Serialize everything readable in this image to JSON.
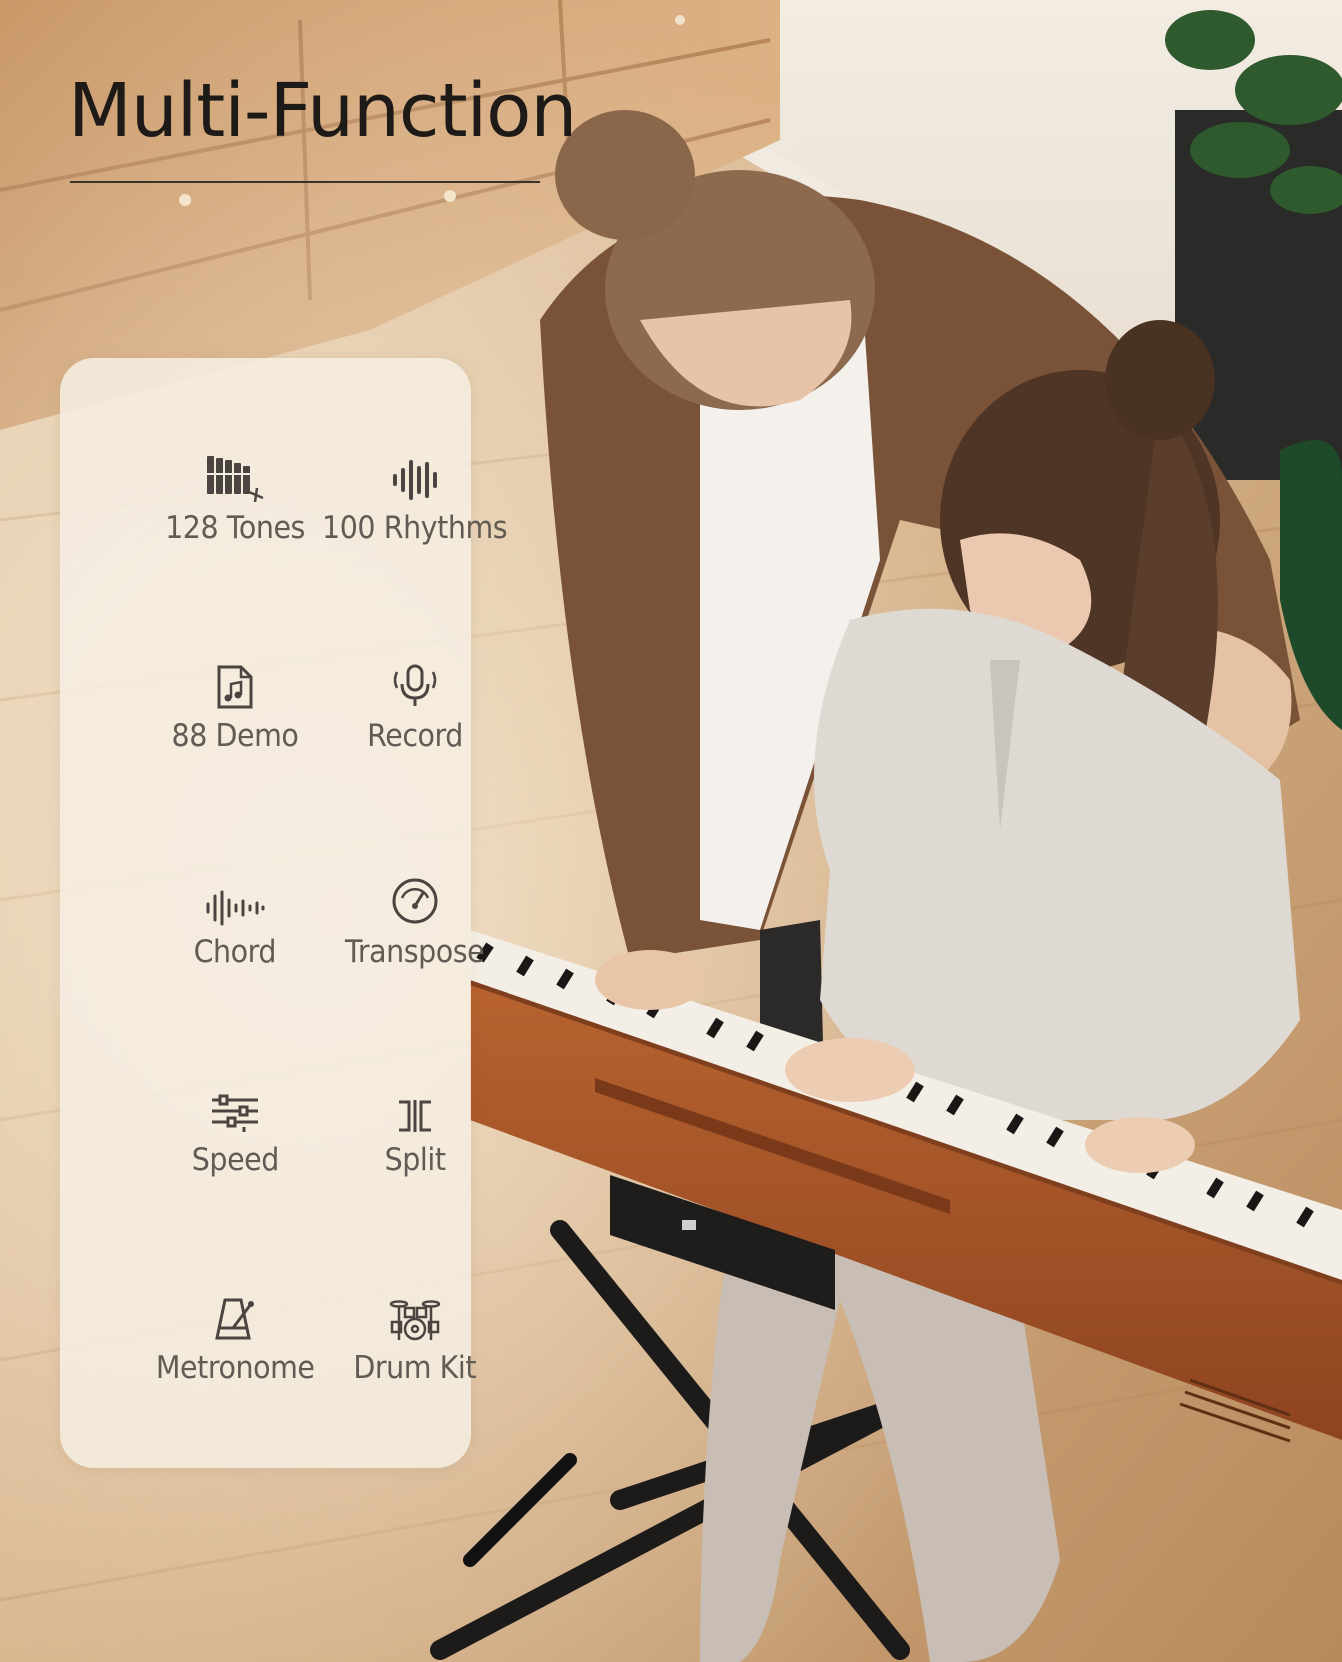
{
  "headline": "Multi-Function",
  "features": [
    {
      "label": "128 Tones",
      "icon": "xylophone-icon"
    },
    {
      "label": "100 Rhythms",
      "icon": "sound-wave-icon"
    },
    {
      "label": "88 Demo",
      "icon": "music-file-icon"
    },
    {
      "label": "Record",
      "icon": "microphone-icon"
    },
    {
      "label": "Chord",
      "icon": "waveform-icon"
    },
    {
      "label": "Transpose",
      "icon": "gauge-icon"
    },
    {
      "label": "Speed",
      "icon": "sliders-icon"
    },
    {
      "label": "Split",
      "icon": "split-icon"
    },
    {
      "label": "Metronome",
      "icon": "metronome-icon"
    },
    {
      "label": "Drum Kit",
      "icon": "drum-kit-icon"
    }
  ],
  "colors": {
    "headline": "#1e1a17",
    "panel": "#f6efe3",
    "label": "#625b54",
    "icon": "#4a4540",
    "piano_wood": "#a8542a"
  }
}
